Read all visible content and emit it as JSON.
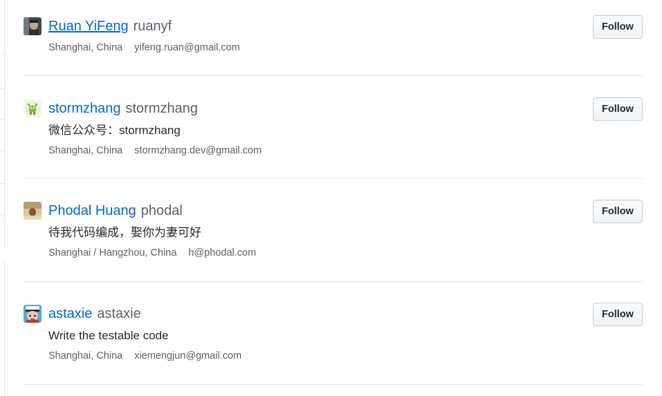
{
  "users": [
    {
      "full_name": "Ruan YiFeng",
      "login": "ruanyf",
      "bio": "",
      "location": "Shanghai, China",
      "email": "yifeng.ruan@gmail.com",
      "follow_label": "Follow"
    },
    {
      "full_name": "stormzhang",
      "login": "stormzhang",
      "bio": "微信公众号：stormzhang",
      "location": "Shanghai, China",
      "email": "stormzhang.dev@gmail.com",
      "follow_label": "Follow"
    },
    {
      "full_name": "Phodal Huang",
      "login": "phodal",
      "bio": "待我代码编成，娶你为妻可好",
      "location": "Shanghai / Hangzhou, China",
      "email": "h@phodal.com",
      "follow_label": "Follow"
    },
    {
      "full_name": "astaxie",
      "login": "astaxie",
      "bio": "Write the testable code",
      "location": "Shanghai, China",
      "email": "xiemengjun@gmail.com",
      "follow_label": "Follow"
    }
  ],
  "colors": {
    "link": "#0366d6",
    "muted": "#586069",
    "text": "#24292e",
    "divider": "#e1e4e8"
  }
}
